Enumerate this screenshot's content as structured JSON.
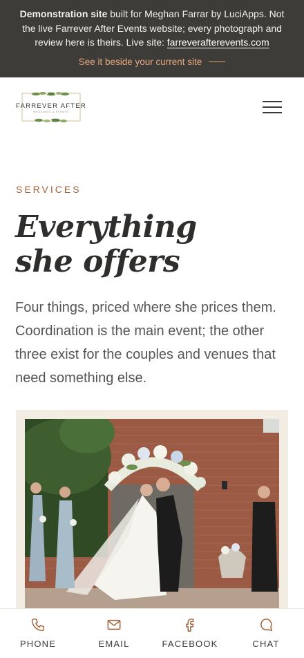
{
  "banner": {
    "strong": "Demonstration site",
    "text_before_link": " built for Meghan Farrar by LuciApps. Not the live Farrever After Events website; every photograph and review here is theirs. Live site: ",
    "link": "farreverafterevents.com",
    "cta": "See it beside your current site"
  },
  "header": {
    "logo_main": "FARREVER AFTER",
    "logo_sub": "WEDDINGS & EVENTS"
  },
  "section": {
    "eyebrow": "SERVICES",
    "heading_line1": "Everything",
    "heading_line2": "she offers",
    "intro": "Four things, priced where she prices them. Coordination is the main event; the other three exist for the couples and venues that need something else."
  },
  "bottom_nav": [
    {
      "label": "PHONE",
      "icon": "phone-icon"
    },
    {
      "label": "EMAIL",
      "icon": "email-icon"
    },
    {
      "label": "FACEBOOK",
      "icon": "facebook-icon"
    },
    {
      "label": "CHAT",
      "icon": "chat-icon"
    }
  ],
  "colors": {
    "banner_bg": "#3d3c39",
    "accent": "#a4633a",
    "cta": "#e7a77c",
    "card_bg": "#f3ece3"
  }
}
